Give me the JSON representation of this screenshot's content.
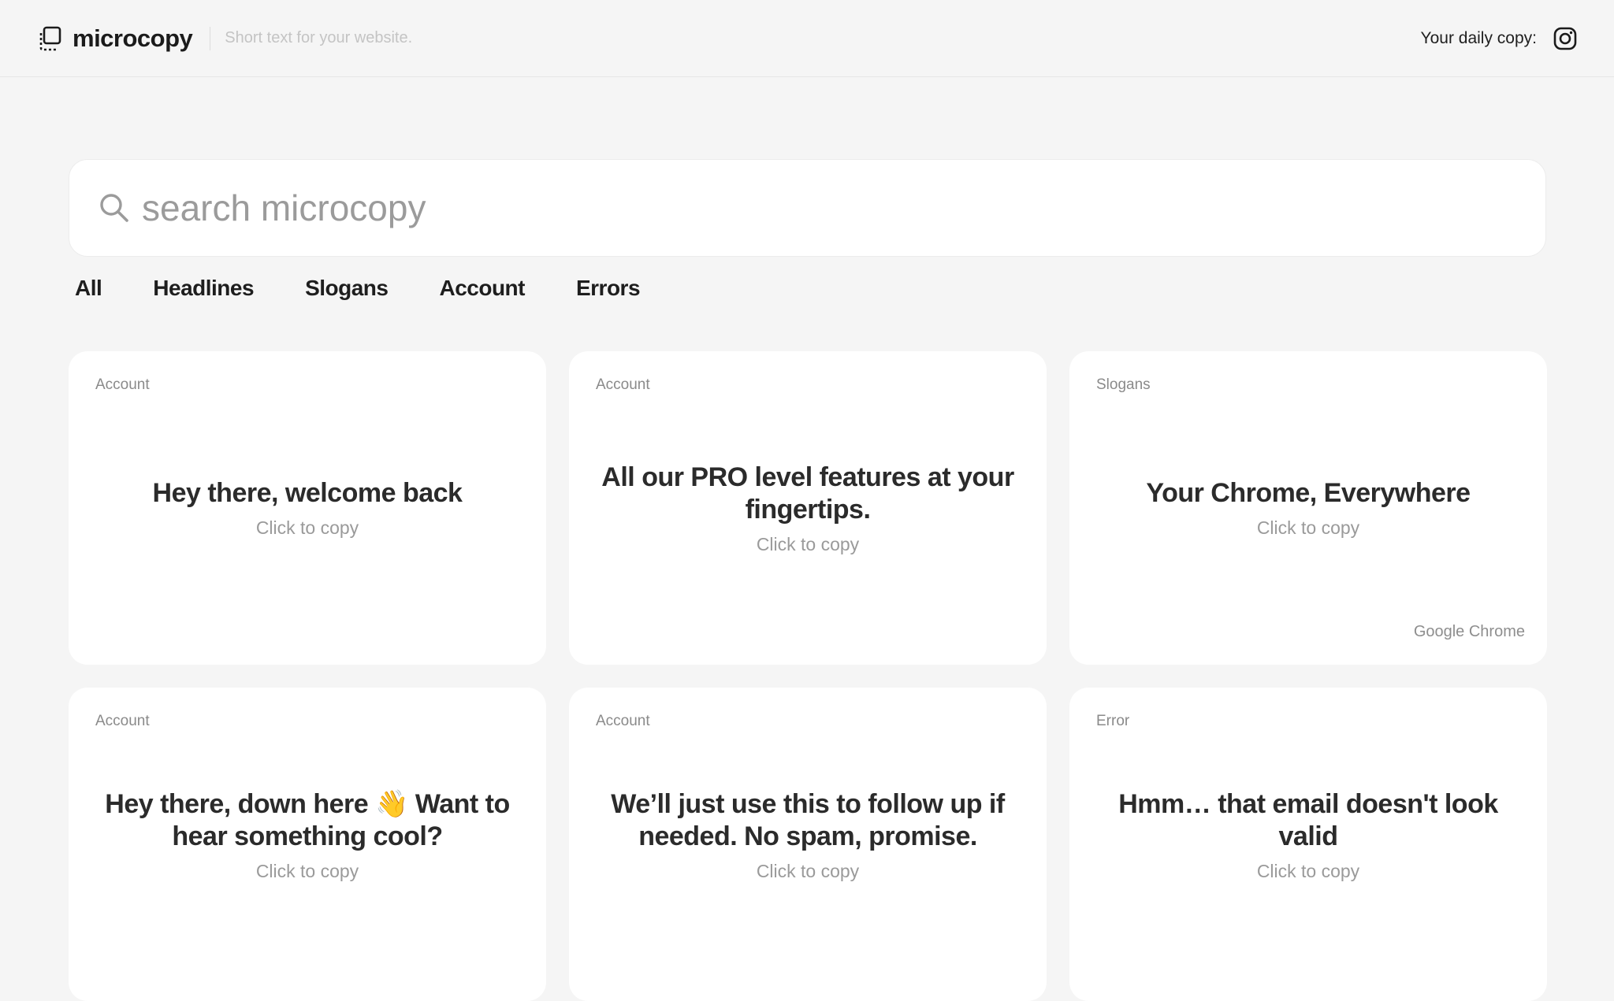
{
  "header": {
    "brand": "microcopy",
    "tagline": "Short text for your website.",
    "daily_label": "Your daily copy:"
  },
  "search": {
    "placeholder": "search microcopy"
  },
  "tabs": [
    {
      "label": "All"
    },
    {
      "label": "Headlines"
    },
    {
      "label": "Slogans"
    },
    {
      "label": "Account"
    },
    {
      "label": "Errors"
    }
  ],
  "cards": [
    {
      "category": "Account",
      "text": "Hey there, welcome back",
      "cta": "Click to copy",
      "source": ""
    },
    {
      "category": "Account",
      "text": "All our PRO level features at your fingertips.",
      "cta": "Click to copy",
      "source": ""
    },
    {
      "category": "Slogans",
      "text": "Your Chrome, Everywhere",
      "cta": "Click to copy",
      "source": "Google Chrome"
    },
    {
      "category": "Account",
      "text": "Hey there, down here 👋 Want to hear something cool?",
      "cta": "Click to copy",
      "source": ""
    },
    {
      "category": "Account",
      "text": "We’ll just use this to follow up if needed. No spam, promise.",
      "cta": "Click to copy",
      "source": ""
    },
    {
      "category": "Error",
      "text": "Hmm… that email doesn't look valid",
      "cta": "Click to copy",
      "source": ""
    }
  ]
}
